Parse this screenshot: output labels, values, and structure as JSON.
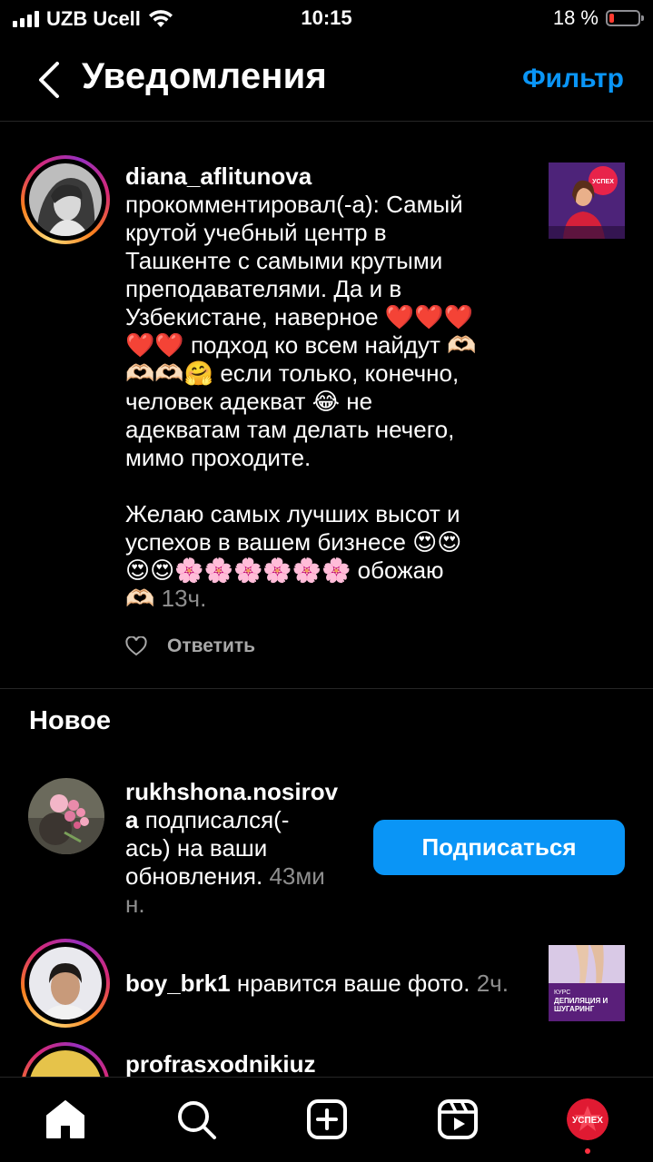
{
  "status_bar": {
    "carrier": "UZB Ucell",
    "time": "10:15",
    "battery_percent_label": "18 %",
    "battery_level": 0.18
  },
  "header": {
    "title": "Уведомления",
    "filter_label": "Фильтр"
  },
  "comment": {
    "username": "diana_aflitunova",
    "text_lines": [
      "прокомментировал(-а): Самый",
      "крутой учебный центр в",
      "Ташкенте с самыми крутыми",
      "преподавателями. Да и в",
      "Узбекистане, наверное ❤️❤️❤️",
      "❤️❤️ подход ко всем найдут 🫶🏻",
      "🫶🏻🫶🏻🤗 если только, конечно,",
      "человек адекват 😂 не",
      "адекватам там делать нечего,",
      "мимо проходите."
    ],
    "text_lines_2": [
      "Желаю самых лучших высот и",
      "успехов в вашем бизнесе 😍😍",
      "😍😍🌸🌸🌸🌸🌸🌸 обожаю"
    ],
    "last_line_emoji": "🫶🏻",
    "time": "13ч.",
    "reply_label": "Ответить"
  },
  "section_new": "Новое",
  "follow_notification": {
    "username_line1": "rukhshona.nosirov",
    "username_line2_bold": "a",
    "text_line2_rest": " подписался(-",
    "text_line3": "ась) на ваши",
    "text_line4": "обновления.",
    "time_part1": "43ми",
    "time_part2": "н.",
    "button_label": "Подписаться"
  },
  "like_notification": {
    "username": "boy_brk1",
    "text": " нравится ваше фото.",
    "time": "2ч.",
    "thumb_text_1": "КУРС",
    "thumb_text_2": "ДЕПИЛЯЦИЯ И",
    "thumb_text_3": "ШУГАРИНГ"
  },
  "partial_notification": {
    "username": "profrasxodnikiuz"
  },
  "comment_thumb_text": "УСПЕХ",
  "profile_tab_text": "УСПЕХ",
  "tabs": [
    "home-tab",
    "search-tab",
    "create-tab",
    "reels-tab",
    "profile-tab"
  ],
  "colors": {
    "accent_blue": "#0a95f6",
    "background": "#000000",
    "divider": "#262626",
    "notification_dot": "#ff3040"
  }
}
